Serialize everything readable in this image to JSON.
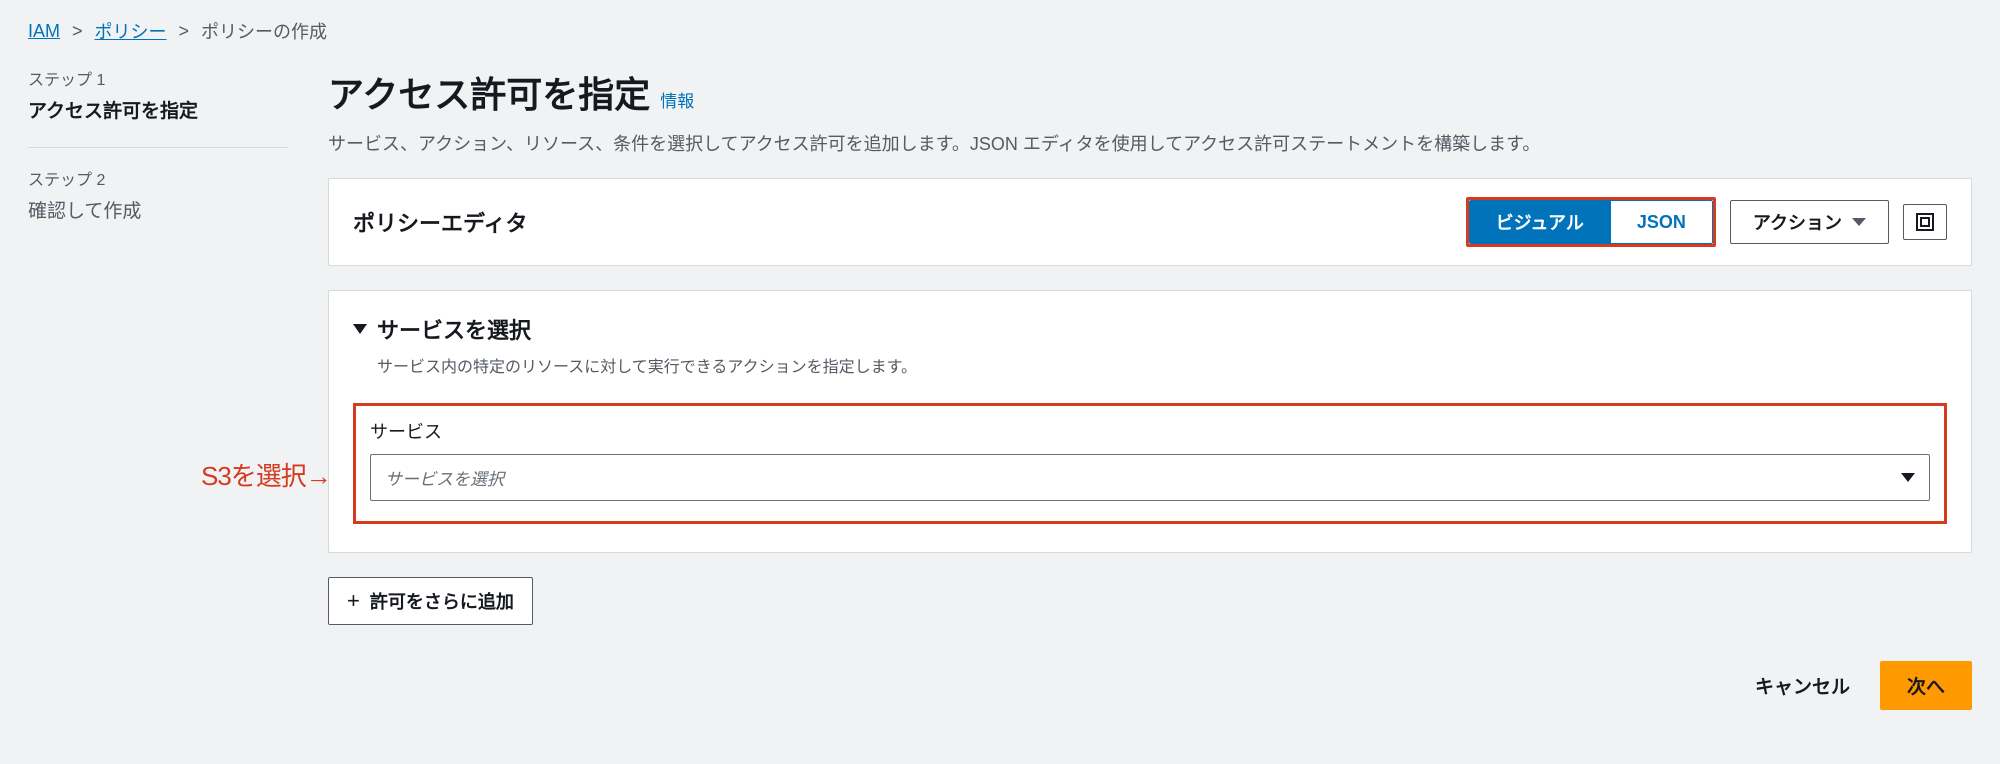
{
  "breadcrumb": {
    "root": "IAM",
    "policies": "ポリシー",
    "current": "ポリシーの作成"
  },
  "steps": [
    {
      "label": "ステップ 1",
      "title": "アクセス許可を指定",
      "active": true
    },
    {
      "label": "ステップ 2",
      "title": "確認して作成",
      "active": false
    }
  ],
  "header": {
    "title": "アクセス許可を指定",
    "info": "情報",
    "desc": "サービス、アクション、リソース、条件を選択してアクセス許可を追加します。JSON エディタを使用してアクセス許可ステートメントを構築します。"
  },
  "editor": {
    "title": "ポリシーエディタ",
    "visual": "ビジュアル",
    "json": "JSON",
    "actions": "アクション"
  },
  "service": {
    "section_title": "サービスを選択",
    "section_desc": "サービス内の特定のリソースに対して実行できるアクションを指定します。",
    "field_label": "サービス",
    "placeholder": "サービスを選択"
  },
  "annotation": "S3を選択→",
  "add_permission": "許可をさらに追加",
  "footer": {
    "cancel": "キャンセル",
    "next": "次へ"
  }
}
